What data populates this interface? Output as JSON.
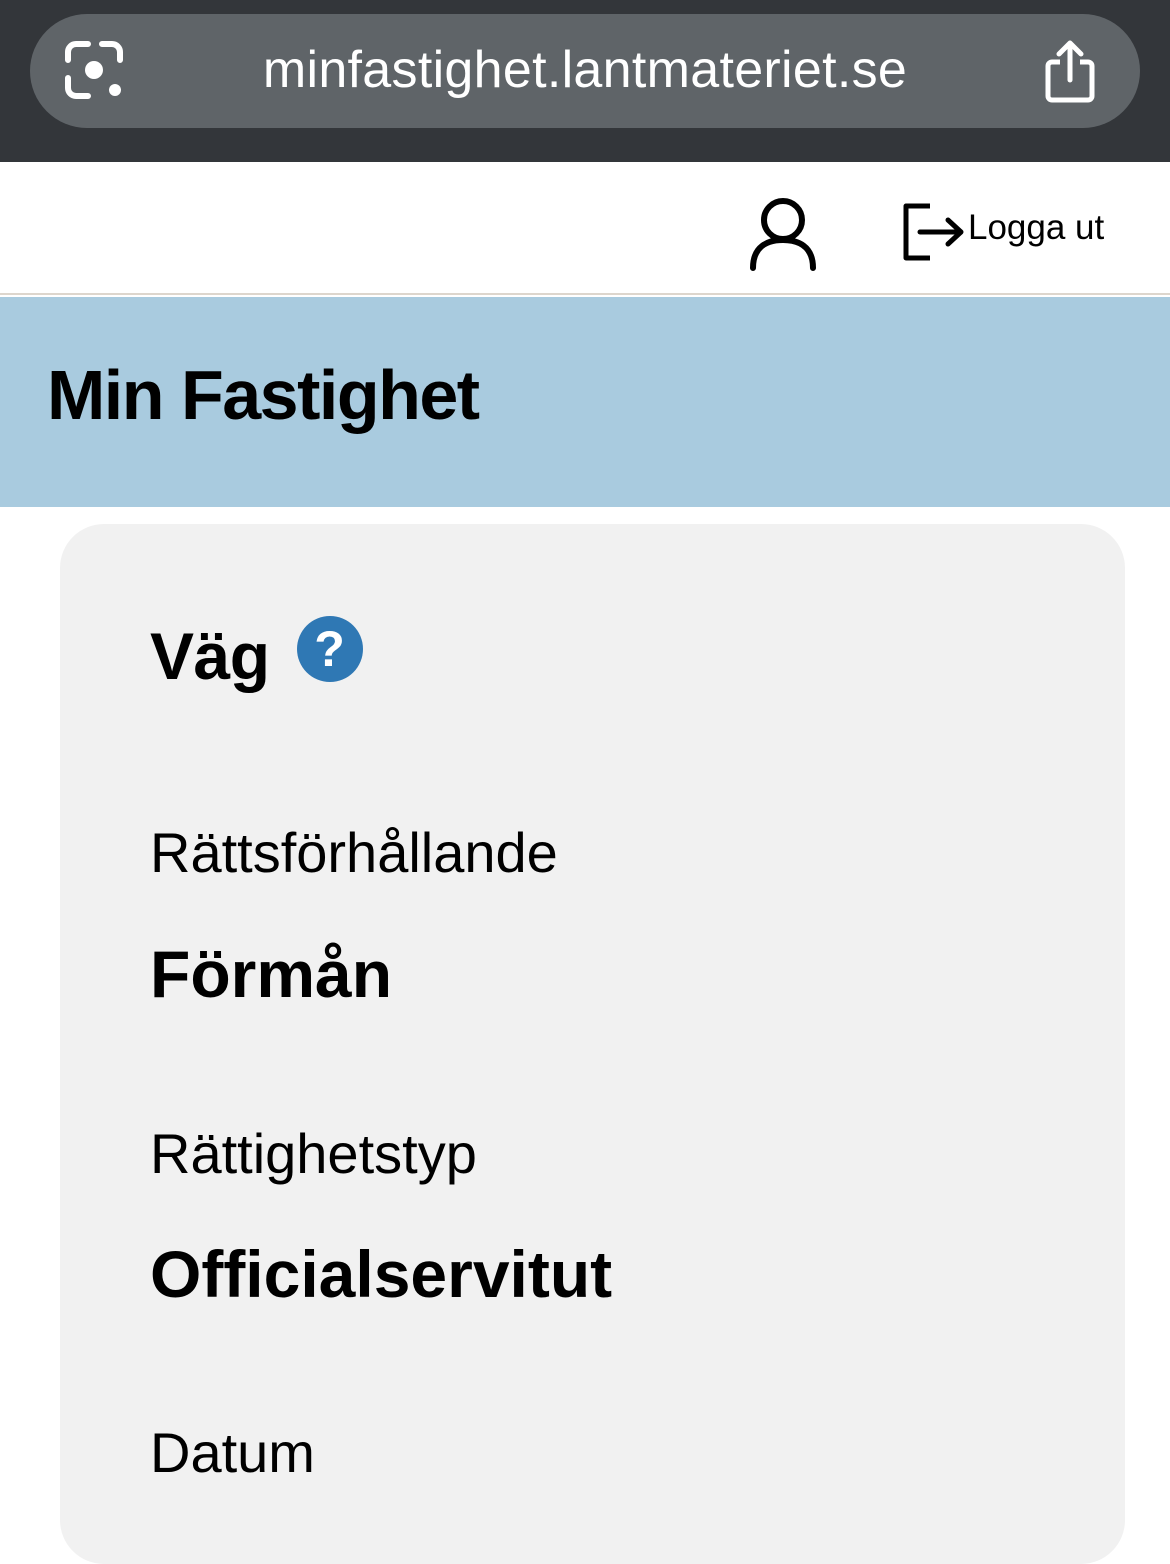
{
  "browser": {
    "url": "minfastighet.lantmateriet.se",
    "lens_icon": "camera-lens-icon",
    "share_icon": "share-icon"
  },
  "nav": {
    "profile_icon": "user-icon",
    "logout_icon": "logout-icon",
    "logout_label": "Logga ut"
  },
  "header": {
    "title": "Min Fastighet"
  },
  "card": {
    "title": "Väg",
    "help_symbol": "?",
    "fields": [
      {
        "label": "Rättsförhållande",
        "value": "Förmån"
      },
      {
        "label": "Rättighetstyp",
        "value": "Officialservitut"
      },
      {
        "label": "Datum"
      }
    ]
  },
  "colors": {
    "browser_bar": "#33363a",
    "url_pill": "#5f6468",
    "header_bg": "#a9cbdf",
    "card_bg": "#f1f1f1",
    "help_icon": "#2f78b4"
  }
}
